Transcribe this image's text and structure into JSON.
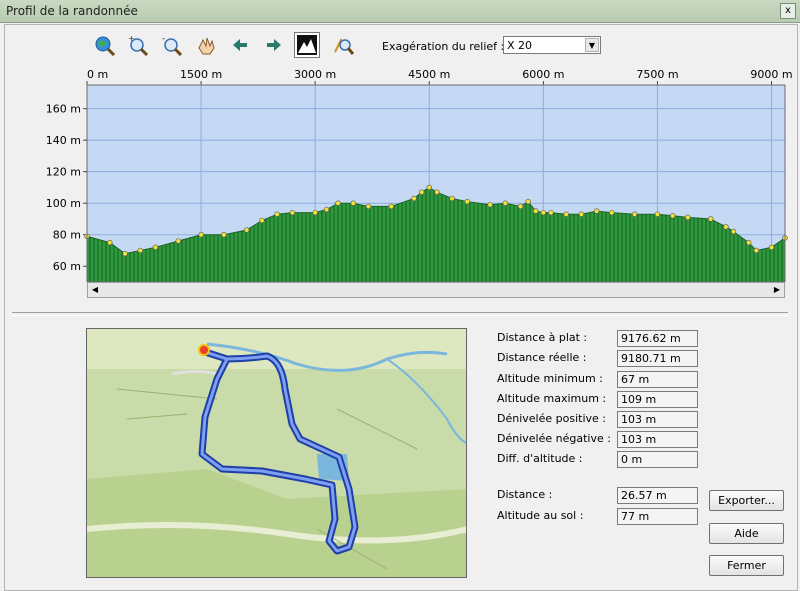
{
  "window": {
    "title": "Profil de la randonnée",
    "close_label": "x"
  },
  "toolbar": {
    "icons": [
      "zoom-globe-icon",
      "zoom-in-icon",
      "zoom-out-icon",
      "pan-hand-icon",
      "arrow-left-icon",
      "arrow-right-icon",
      "relief-mountain-icon",
      "profile-tool-icon"
    ],
    "relief_label": "Exagération du relief :",
    "relief_value": "X 20"
  },
  "chart_data": {
    "type": "area",
    "title": "",
    "xlabel": "",
    "ylabel": "",
    "x_unit": "m",
    "y_unit": "m",
    "xlim": [
      0,
      9177
    ],
    "ylim": [
      50,
      175
    ],
    "x_ticks": [
      "0 m",
      "1500 m",
      "3000 m",
      "4500 m",
      "6000 m",
      "7500 m",
      "9000 m"
    ],
    "y_ticks": [
      "160 m",
      "140 m",
      "120 m",
      "100 m",
      "80 m",
      "60 m"
    ],
    "grid": true,
    "colors": {
      "background": "#c5d8f4",
      "fill": "#2e9a3e",
      "grid": "#8eaee0",
      "marker": "#f0e040"
    },
    "series": [
      {
        "x": [
          0,
          300,
          500,
          700,
          900,
          1200,
          1500,
          1800,
          2100,
          2300,
          2500,
          2700,
          3000,
          3150,
          3300,
          3500,
          3700,
          4000,
          4300,
          4400,
          4500,
          4600,
          4800,
          5000,
          5300,
          5500,
          5700,
          5800,
          5900,
          6000,
          6100,
          6300,
          6500,
          6700,
          6900,
          7200,
          7500,
          7700,
          7900,
          8200,
          8400,
          8500,
          8700,
          8800,
          9000,
          9177
        ],
        "values": [
          79,
          75,
          68,
          70,
          72,
          76,
          80,
          80,
          83,
          89,
          93,
          94,
          94,
          96,
          100,
          100,
          98,
          98,
          103,
          107,
          110,
          107,
          103,
          101,
          99,
          100,
          98,
          101,
          95,
          94,
          94,
          93,
          93,
          95,
          94,
          93,
          93,
          92,
          91,
          90,
          85,
          82,
          75,
          70,
          72,
          78
        ]
      }
    ]
  },
  "stats": [
    {
      "label": "Distance à plat :",
      "value": "9176.62 m"
    },
    {
      "label": "Distance réelle :",
      "value": "9180.71 m"
    },
    {
      "label": "Altitude minimum :",
      "value": "67 m"
    },
    {
      "label": "Altitude maximum :",
      "value": "109 m"
    },
    {
      "label": "Dénivelée positive :",
      "value": "103 m"
    },
    {
      "label": "Dénivelée négative :",
      "value": "103 m"
    },
    {
      "label": "Diff. d'altitude :",
      "value": "0 m"
    },
    {
      "label": "Distance :",
      "value": "26.57 m"
    },
    {
      "label": "Altitude au sol :",
      "value": "77 m"
    }
  ],
  "buttons": {
    "export": "Exporter...",
    "help": "Aide",
    "close": "Fermer"
  }
}
